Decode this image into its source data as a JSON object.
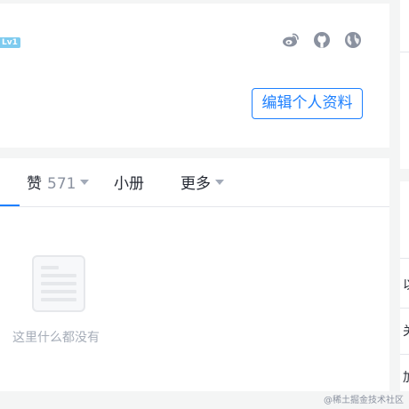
{
  "profile": {
    "level": "Lv1",
    "edit_button": "编辑个人资料",
    "social_icons": [
      "weibo-icon",
      "github-icon",
      "globe-icon"
    ]
  },
  "tabs": [
    {
      "label": "赞",
      "count": "571",
      "has_caret": true,
      "active": true
    },
    {
      "label": "小册",
      "count": "",
      "has_caret": false,
      "active": false
    },
    {
      "label": "更多",
      "count": "",
      "has_caret": true,
      "active": false
    }
  ],
  "empty_state": {
    "text": "这里什么都没有"
  },
  "sidebar_fragments": [
    "以",
    "关",
    "加"
  ],
  "watermark": "@稀土掘金技术社区",
  "colors": {
    "accent": "#1e80ff",
    "background": "#f4f5f5",
    "level_badge": "#7ecbef",
    "icon_gray": "#8a919f"
  }
}
